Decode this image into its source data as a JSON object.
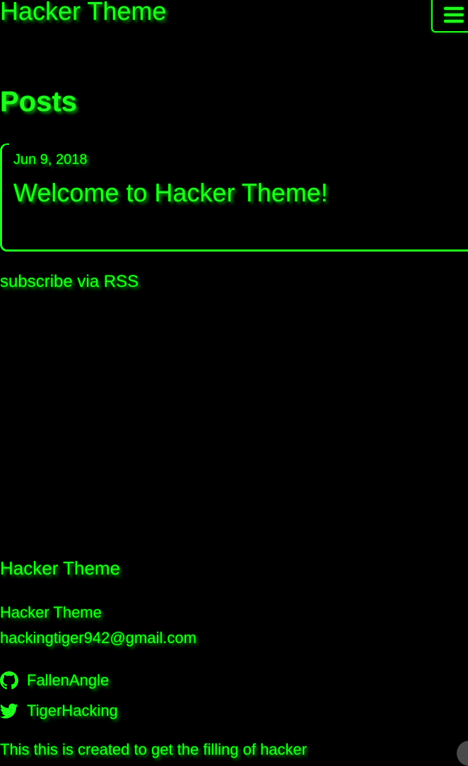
{
  "header": {
    "site_title": "Hacker Theme",
    "menu_icon": "hamburger-menu-icon"
  },
  "main": {
    "heading": "Posts",
    "posts": [
      {
        "date": "Jun 9, 2018",
        "title": "Welcome to Hacker Theme!"
      }
    ],
    "rss_link": "subscribe via RSS"
  },
  "footer": {
    "heading": "Hacker Theme",
    "name": "Hacker Theme",
    "email": "hackingtiger942@gmail.com",
    "social": [
      {
        "icon": "github-icon",
        "label": "FallenAngle"
      },
      {
        "icon": "twitter-icon",
        "label": "TigerHacking"
      }
    ],
    "description": "This this is created to get the filling of hacker"
  },
  "colors": {
    "background": "#000000",
    "accent": "#1fff1f"
  }
}
